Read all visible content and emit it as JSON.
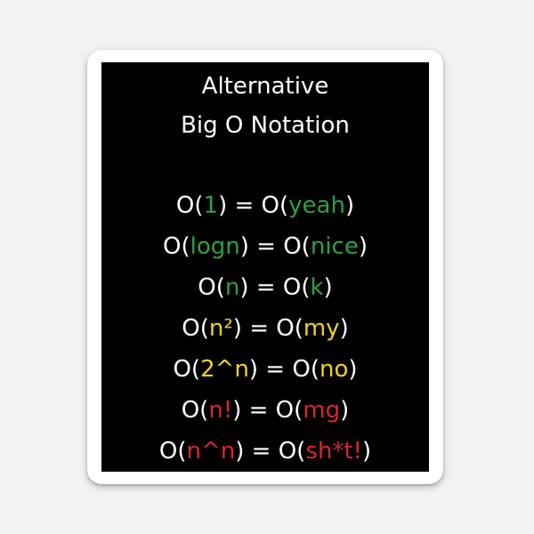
{
  "title": {
    "line1": "Alternative",
    "line2": "Big O Notation"
  },
  "colors": {
    "background": "#000000",
    "text": "#ffffff",
    "green": "#2ea043",
    "yellow": "#f2d21b",
    "red": "#d9262b"
  },
  "equations": [
    {
      "prefix": "O(",
      "left": "1",
      "middle": ") = O(",
      "right": "yeah",
      "suffix": ")",
      "color": "green"
    },
    {
      "prefix": "O(",
      "left": "logn",
      "middle": ") = O(",
      "right": "nice",
      "suffix": ")",
      "color": "green"
    },
    {
      "prefix": "O(",
      "left": "n",
      "middle": ") = O(",
      "right": "k",
      "suffix": ")",
      "color": "green"
    },
    {
      "prefix": "O(",
      "left": "n²",
      "middle": ") = O(",
      "right": "my",
      "suffix": ")",
      "color": "yellow"
    },
    {
      "prefix": "O(",
      "left": "2^n",
      "middle": ") = O(",
      "right": "no",
      "suffix": ")",
      "color": "yellow"
    },
    {
      "prefix": "O(",
      "left": "n!",
      "middle": ") = O(",
      "right": "mg",
      "suffix": ")",
      "color": "red"
    },
    {
      "prefix": "O(",
      "left": "n^n",
      "middle": ") = O(",
      "right": "sh*t!",
      "suffix": ")",
      "color": "red"
    }
  ]
}
